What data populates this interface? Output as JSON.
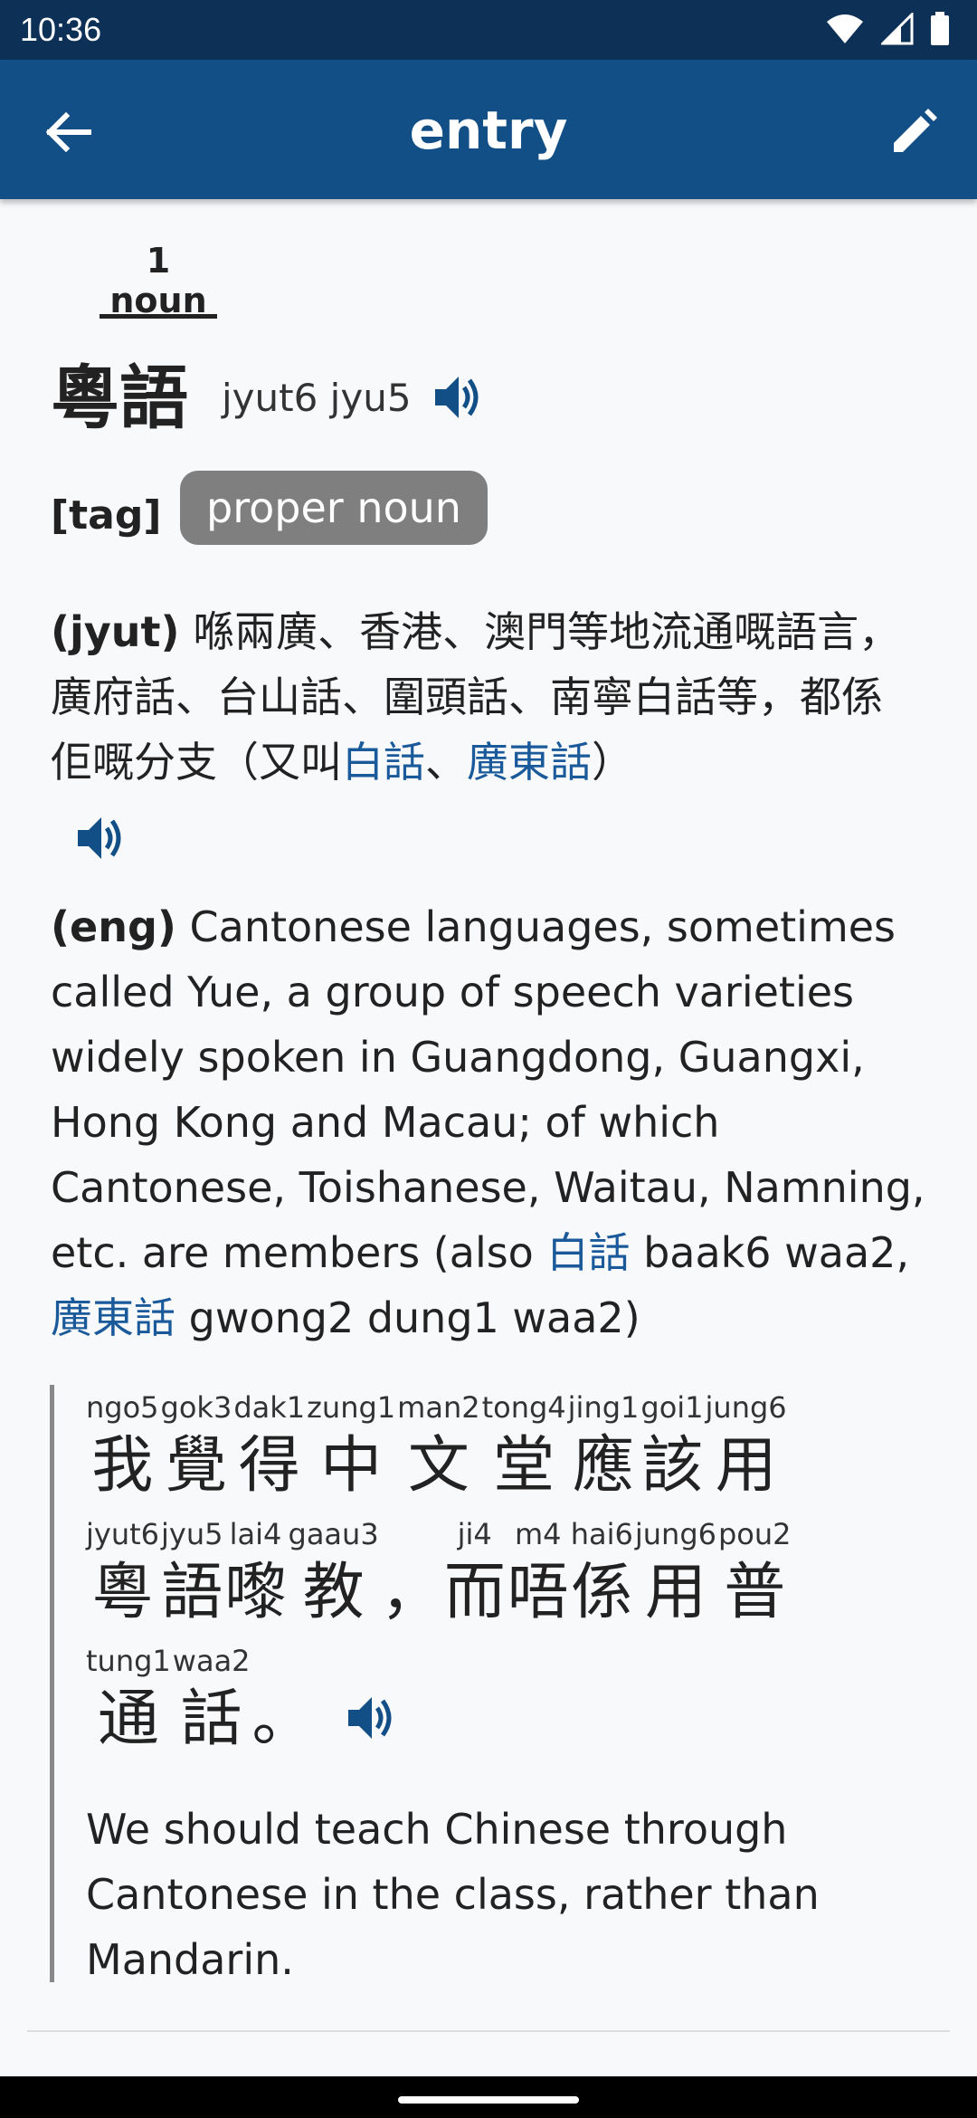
{
  "status_bar": {
    "time": "10:36",
    "icons": [
      "wifi-icon",
      "signal-icon",
      "battery-icon"
    ]
  },
  "app_bar": {
    "title": "entry",
    "back_icon": "arrow-left-icon",
    "edit_icon": "pencil-icon"
  },
  "tabs": [
    {
      "label": "1 noun",
      "selected": true
    }
  ],
  "entry": {
    "headword": "粵語",
    "jyutping": "jyut6 jyu5",
    "tag_label": "[tag]",
    "tag_value": "proper noun",
    "yue_definition": {
      "lang": "(jyut)",
      "text_before": " 喺兩廣、香港、澳門等地流通嘅語言，廣府話、台山話、圍頭話、南寧白話等，都係佢嘅分支（又叫",
      "link1": "白話",
      "sep": "、",
      "link2": "廣東話",
      "text_after": "）"
    },
    "eng_definition": {
      "lang": "(eng)",
      "text_before": " Cantonese languages, sometimes called Yue, a group of speech varieties widely spoken in Guangdong, Guangxi, Hong Kong and Macau; of which Cantonese, Toishanese, Waitau, Namning, etc. are members (also ",
      "link1": "白話",
      "mid": " baak6 waa2, ",
      "link2": "廣東話",
      "text_after": " gwong2 dung1 waa2)"
    },
    "example": {
      "lines": [
        [
          {
            "rt": "ngo5",
            "rb": "我"
          },
          {
            "rt": "gok3",
            "rb": "覺"
          },
          {
            "rt": "dak1",
            "rb": "得"
          },
          {
            "rt": "zung1",
            "rb": "中"
          },
          {
            "rt": "man2",
            "rb": "文"
          },
          {
            "rt": "tong4",
            "rb": "堂"
          },
          {
            "rt": "jing1",
            "rb": "應"
          },
          {
            "rt": "goi1",
            "rb": "該"
          },
          {
            "rt": "jung6",
            "rb": "用"
          }
        ],
        [
          {
            "rt": "jyut6",
            "rb": "粵"
          },
          {
            "rt": "jyu5",
            "rb": "語"
          },
          {
            "rt": "lai4",
            "rb": "嚟"
          },
          {
            "rt": "gaau3",
            "rb": "教"
          },
          {
            "rt": "",
            "rb": "，"
          },
          {
            "rt": "ji4",
            "rb": "而"
          },
          {
            "rt": "m4",
            "rb": "唔"
          },
          {
            "rt": "hai6",
            "rb": "係"
          },
          {
            "rt": "jung6",
            "rb": "用"
          },
          {
            "rt": "pou2",
            "rb": "普"
          }
        ],
        [
          {
            "rt": "tung1",
            "rb": "通"
          },
          {
            "rt": "waa2",
            "rb": "話"
          },
          {
            "rt": "",
            "rb": "。"
          }
        ]
      ],
      "translation": "We should teach Chinese through Cantonese in the class, rather than Mandarin."
    }
  },
  "colors": {
    "status_bar": "#0d3056",
    "app_bar": "#124f86",
    "link": "#1a5a9b",
    "tag_badge": "#7f7f7f"
  }
}
